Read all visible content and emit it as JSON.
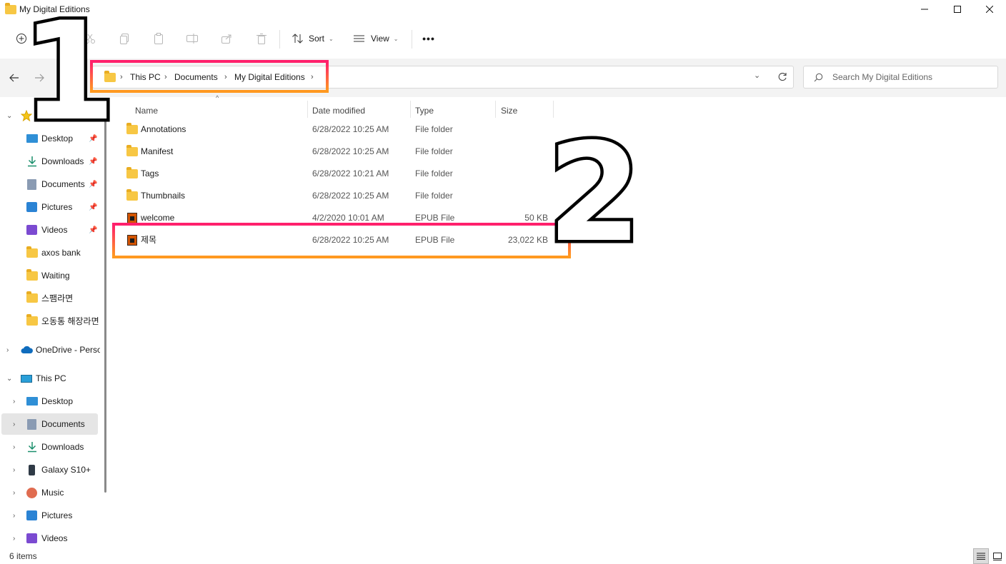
{
  "window": {
    "title": "My Digital Editions"
  },
  "toolbar": {
    "new_icon": "plus-circle-icon",
    "sort_label": "Sort",
    "view_label": "View",
    "more_label": "•••"
  },
  "address": {
    "crumbs": [
      "This PC",
      "Documents",
      "My Digital Editions"
    ],
    "search_placeholder": "Search My Digital Editions"
  },
  "sidebar": {
    "quick_access": {
      "label": "Quick access",
      "items": [
        {
          "label": "Desktop",
          "pinned": true
        },
        {
          "label": "Downloads",
          "pinned": true
        },
        {
          "label": "Documents",
          "pinned": true
        },
        {
          "label": "Pictures",
          "pinned": true
        },
        {
          "label": "Videos",
          "pinned": true
        },
        {
          "label": "axos bank"
        },
        {
          "label": "Waiting"
        },
        {
          "label": "스팸라면"
        },
        {
          "label": "오동통 해장라면"
        }
      ]
    },
    "onedrive": "OneDrive - Personal",
    "this_pc": {
      "label": "This PC",
      "items": [
        "Desktop",
        "Documents",
        "Downloads",
        "Galaxy S10+",
        "Music",
        "Pictures",
        "Videos"
      ],
      "selected": "Documents"
    }
  },
  "columns": [
    "Name",
    "Date modified",
    "Type",
    "Size"
  ],
  "files": [
    {
      "name": "Annotations",
      "date": "6/28/2022 10:25 AM",
      "type": "File folder",
      "size": ""
    },
    {
      "name": "Manifest",
      "date": "6/28/2022 10:25 AM",
      "type": "File folder",
      "size": ""
    },
    {
      "name": "Tags",
      "date": "6/28/2022 10:21 AM",
      "type": "File folder",
      "size": ""
    },
    {
      "name": "Thumbnails",
      "date": "6/28/2022 10:25 AM",
      "type": "File folder",
      "size": ""
    },
    {
      "name": "welcome",
      "date": "4/2/2020 10:01 AM",
      "type": "EPUB File",
      "size": "50 KB"
    },
    {
      "name": "제목",
      "date": "6/28/2022 10:25 AM",
      "type": "EPUB File",
      "size": "23,022 KB"
    }
  ],
  "status": {
    "count": "6 items"
  },
  "annotations": {
    "one": "1",
    "two": "2"
  },
  "colors": {
    "highlight_top": "#ff1f6d",
    "highlight_bottom": "#ff9a1f",
    "folder": "#f7c744",
    "selected_bg": "#e5e5e5"
  }
}
